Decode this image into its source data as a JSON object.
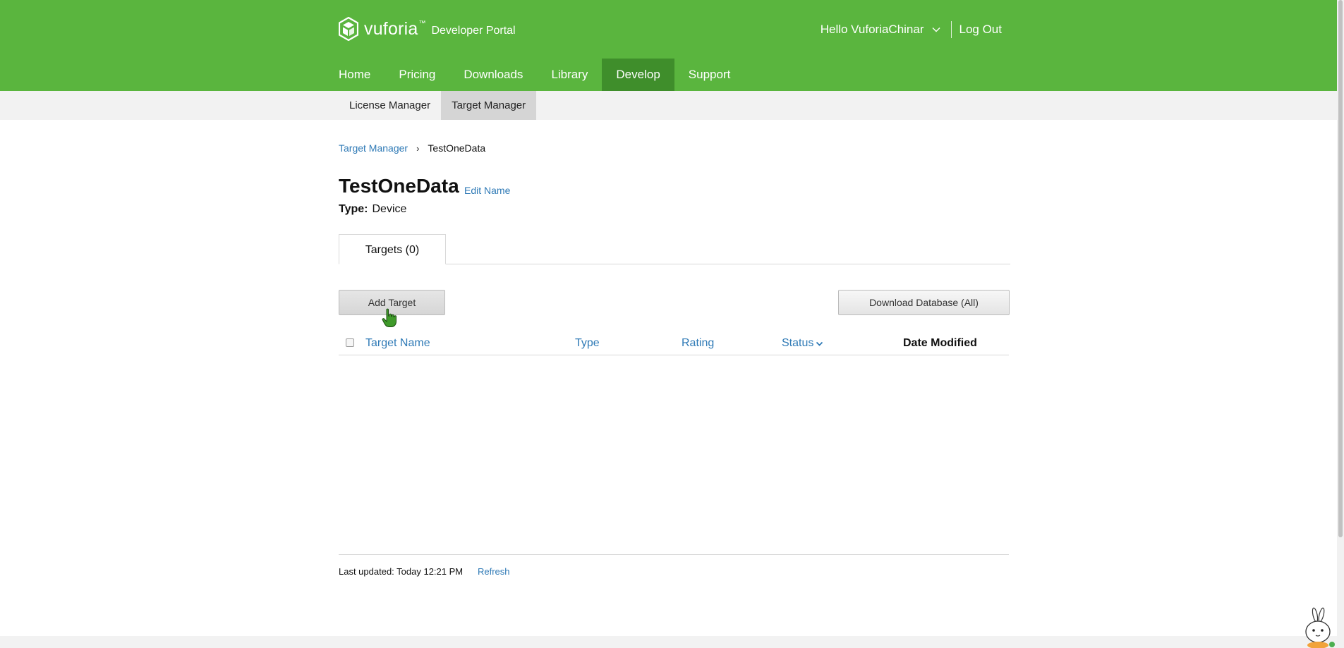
{
  "header": {
    "brand": "vuforia",
    "trademark": "™",
    "portal": "Developer Portal",
    "greeting": "Hello VuforiaChinar",
    "logout": "Log Out",
    "brand_color": "#5ab53e",
    "active_nav_color": "#3f8e2b"
  },
  "nav": {
    "items": [
      {
        "label": "Home"
      },
      {
        "label": "Pricing"
      },
      {
        "label": "Downloads"
      },
      {
        "label": "Library"
      },
      {
        "label": "Develop"
      },
      {
        "label": "Support"
      }
    ],
    "active": "Develop"
  },
  "subnav": {
    "items": [
      {
        "label": "License Manager"
      },
      {
        "label": "Target Manager"
      }
    ],
    "active": "Target Manager"
  },
  "breadcrumb": {
    "parent": "Target Manager",
    "current": "TestOneData"
  },
  "database": {
    "name": "TestOneData",
    "edit_label": "Edit Name",
    "type_label": "Type:",
    "type_value": "Device"
  },
  "tabs": {
    "targets": "Targets (0)"
  },
  "actions": {
    "add_target": "Add Target",
    "download_database": "Download Database (All)"
  },
  "table": {
    "columns": {
      "name": "Target Name",
      "type": "Type",
      "rating": "Rating",
      "status": "Status",
      "date": "Date Modified"
    },
    "rows": []
  },
  "footer": {
    "last_updated": "Last updated: Today 12:21 PM",
    "refresh": "Refresh"
  },
  "link_color": "#2f7ab6"
}
